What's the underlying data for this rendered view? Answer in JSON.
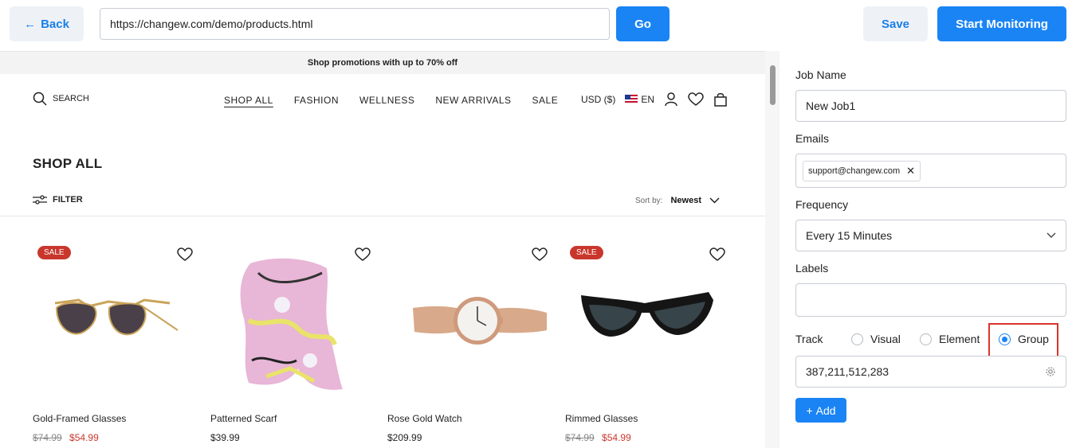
{
  "toolbar": {
    "back_label": "Back",
    "url_value": "https://changew.com/demo/products.html",
    "go_label": "Go",
    "save_label": "Save",
    "start_label": "Start Monitoring"
  },
  "site": {
    "promo": "Shop promotions with up to 70% off",
    "search_label": "SEARCH",
    "menu": [
      "SHOP ALL",
      "FASHION",
      "WELLNESS",
      "NEW ARRIVALS",
      "SALE"
    ],
    "currency": "USD ($)",
    "language": "EN",
    "page_title": "SHOP ALL",
    "filter_label": "FILTER",
    "sort_label": "Sort by:",
    "sort_value": "Newest",
    "products": [
      {
        "name": "Gold-Framed Glasses",
        "badge": "SALE",
        "old_price": "$74.99",
        "price": "$54.99"
      },
      {
        "name": "Patterned Scarf",
        "badge": "",
        "old_price": "",
        "price": "$39.99"
      },
      {
        "name": "Rose Gold Watch",
        "badge": "",
        "old_price": "",
        "price": "$209.99"
      },
      {
        "name": "Rimmed Glasses",
        "badge": "SALE",
        "old_price": "$74.99",
        "price": "$54.99"
      }
    ]
  },
  "panel": {
    "job_name_label": "Job Name",
    "job_name_value": "New Job1",
    "emails_label": "Emails",
    "email_chip": "support@changew.com",
    "frequency_label": "Frequency",
    "frequency_value": "Every 15 Minutes",
    "labels_label": "Labels",
    "labels_value": "",
    "track_label": "Track",
    "track_options": [
      "Visual",
      "Element",
      "Group"
    ],
    "track_selected": "Group",
    "selector_value": "387,211,512,283",
    "add_label": "Add"
  },
  "colors": {
    "accent": "#1a84f5",
    "sale": "#c9372c",
    "highlight": "#d9342b"
  }
}
